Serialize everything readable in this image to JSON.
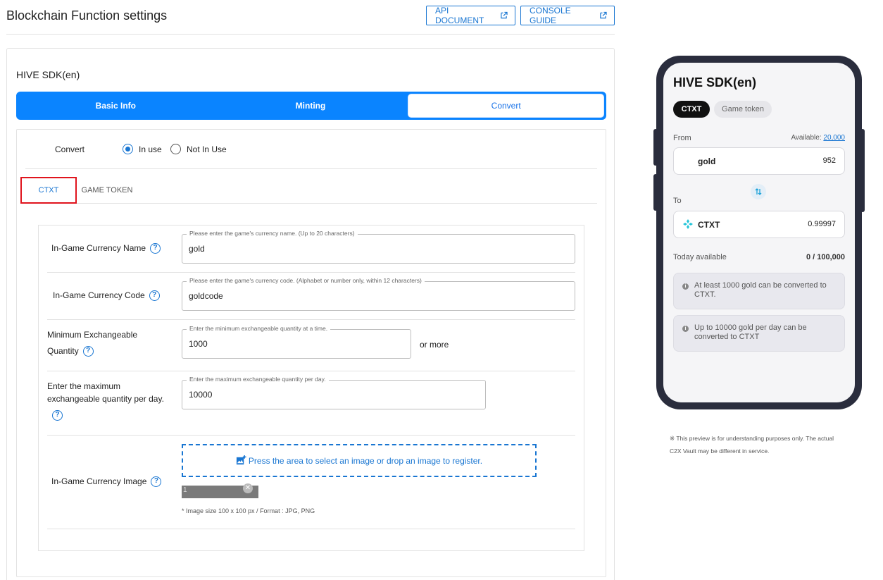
{
  "header": {
    "title": "Blockchain Function settings",
    "api_document": "API DOCUMENT",
    "console_guide": "CONSOLE GUIDE"
  },
  "main": {
    "sdk_title": "HIVE SDK(en)",
    "tabs": [
      {
        "label": "Basic Info",
        "active": false
      },
      {
        "label": "Minting",
        "active": false
      },
      {
        "label": "Convert",
        "active": true
      }
    ],
    "convert": {
      "label": "Convert",
      "options": [
        {
          "label": "In use",
          "selected": true
        },
        {
          "label": "Not In Use",
          "selected": false
        }
      ]
    },
    "subtabs": [
      {
        "label": "CTXT",
        "active": true
      },
      {
        "label": "GAME TOKEN",
        "active": false
      }
    ],
    "form": {
      "currency_name": {
        "label": "In-Game Currency Name",
        "legend": "Please enter the game's currency name. (Up to 20 characters)",
        "value": "gold"
      },
      "currency_code": {
        "label": "In-Game Currency Code",
        "legend": "Please enter the game's currency code. (Alphabet or number only, within 12 characters)",
        "value": "goldcode"
      },
      "min_qty": {
        "label_line1": "Minimum Exchangeable",
        "label_line2": "Quantity",
        "legend": "Enter the minimum exchangeable quantity at a time.",
        "value": "1000",
        "suffix": "or more"
      },
      "max_qty": {
        "label_line1": "Enter the maximum",
        "label_line2": "exchangeable quantity per day.",
        "legend": "Enter the maximum exchangeable quantity per day.",
        "value": "10000"
      },
      "image": {
        "label": "In-Game Currency Image",
        "dropzone": "Press the area to select an image or drop an image to register.",
        "note": "* Image size 100 x 100 px / Format : JPG, PNG",
        "broken_alt": "1"
      },
      "help_glyph": "?"
    }
  },
  "preview": {
    "title": "HIVE SDK(en)",
    "chips": [
      "CTXT",
      "Game token"
    ],
    "from_label": "From",
    "available_label": "Available:",
    "available_value": "20,000",
    "from_name": "gold",
    "from_amount": "952",
    "to_label": "To",
    "to_name": "CTXT",
    "to_amount": "0.99997",
    "today_label": "Today available",
    "today_value": "0 / 100,000",
    "notes": [
      "At least 1000 gold can be converted to CTXT.",
      "Up to 10000 gold per day can be converted to CTXT"
    ],
    "disclaimer": "※ This preview is for understanding purposes only. The actual C2X Vault may be different in service."
  },
  "colors": {
    "accent": "#1976d2",
    "tab_bar": "#0a84ff",
    "highlight_border": "#e0141d",
    "ctxt_logo": "#22c4d8"
  }
}
